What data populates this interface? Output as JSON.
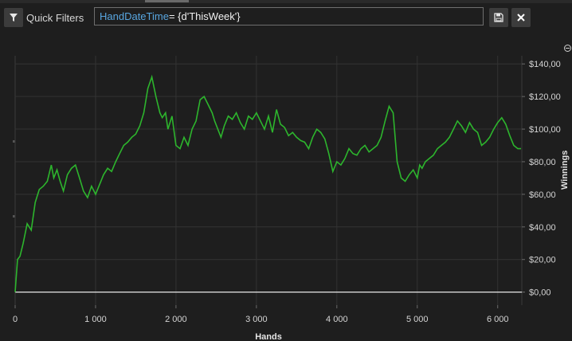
{
  "toolbar": {
    "quick_filters_label": "Quick Filters",
    "query_field": "HandDateTime",
    "query_operator": "= ",
    "query_value": "{d'ThisWeek'}"
  },
  "chart_data": {
    "type": "line",
    "xlabel": "Hands",
    "ylabel": "Winnings",
    "x_ticks": [
      "0",
      "1 000",
      "2 000",
      "3 000",
      "4 000",
      "5 000",
      "6 000"
    ],
    "y_ticks": [
      "$0,00",
      "$20,00",
      "$40,00",
      "$60,00",
      "$80,00",
      "$100,00",
      "$120,00",
      "$140,00"
    ],
    "xlim": [
      0,
      6300
    ],
    "ylim": [
      -8,
      145
    ],
    "grid": true,
    "series": [
      {
        "color": "#2db52d",
        "x": [
          0,
          30,
          60,
          100,
          150,
          200,
          250,
          300,
          350,
          400,
          450,
          480,
          520,
          560,
          600,
          650,
          700,
          750,
          800,
          850,
          900,
          950,
          1000,
          1050,
          1100,
          1150,
          1200,
          1250,
          1300,
          1350,
          1400,
          1450,
          1500,
          1550,
          1600,
          1650,
          1700,
          1750,
          1800,
          1830,
          1870,
          1900,
          1950,
          2000,
          2050,
          2100,
          2150,
          2200,
          2250,
          2300,
          2350,
          2400,
          2450,
          2480,
          2520,
          2560,
          2600,
          2650,
          2700,
          2750,
          2800,
          2850,
          2900,
          2950,
          3000,
          3050,
          3100,
          3150,
          3200,
          3250,
          3300,
          3350,
          3400,
          3450,
          3500,
          3550,
          3600,
          3650,
          3700,
          3750,
          3800,
          3850,
          3900,
          3950,
          4000,
          4050,
          4100,
          4150,
          4200,
          4250,
          4300,
          4350,
          4400,
          4450,
          4500,
          4550,
          4600,
          4650,
          4700,
          4750,
          4800,
          4850,
          4900,
          4950,
          5000,
          5030,
          5060,
          5100,
          5150,
          5200,
          5250,
          5300,
          5350,
          5400,
          5450,
          5500,
          5550,
          5600,
          5650,
          5700,
          5750,
          5800,
          5850,
          5900,
          5950,
          6000,
          6050,
          6100,
          6150,
          6200,
          6250,
          6290
        ],
        "y": [
          0,
          20,
          22,
          30,
          42,
          38,
          55,
          63,
          65,
          68,
          78,
          70,
          75,
          68,
          62,
          72,
          76,
          78,
          70,
          62,
          58,
          65,
          60,
          66,
          72,
          76,
          74,
          80,
          85,
          90,
          92,
          95,
          97,
          102,
          110,
          125,
          132,
          120,
          110,
          107,
          110,
          100,
          108,
          90,
          88,
          95,
          90,
          100,
          105,
          118,
          120,
          115,
          110,
          105,
          100,
          95,
          102,
          108,
          106,
          110,
          104,
          100,
          108,
          106,
          110,
          105,
          100,
          108,
          98,
          112,
          103,
          101,
          96,
          98,
          95,
          93,
          92,
          88,
          95,
          100,
          98,
          94,
          85,
          74,
          80,
          78,
          82,
          88,
          85,
          84,
          88,
          90,
          86,
          88,
          90,
          95,
          105,
          114,
          110,
          80,
          70,
          68,
          72,
          75,
          70,
          78,
          76,
          80,
          82,
          84,
          88,
          90,
          92,
          95,
          100,
          105,
          102,
          98,
          104,
          100,
          98,
          90,
          92,
          95,
          100,
          104,
          107,
          103,
          96,
          90,
          88,
          88
        ]
      }
    ]
  }
}
